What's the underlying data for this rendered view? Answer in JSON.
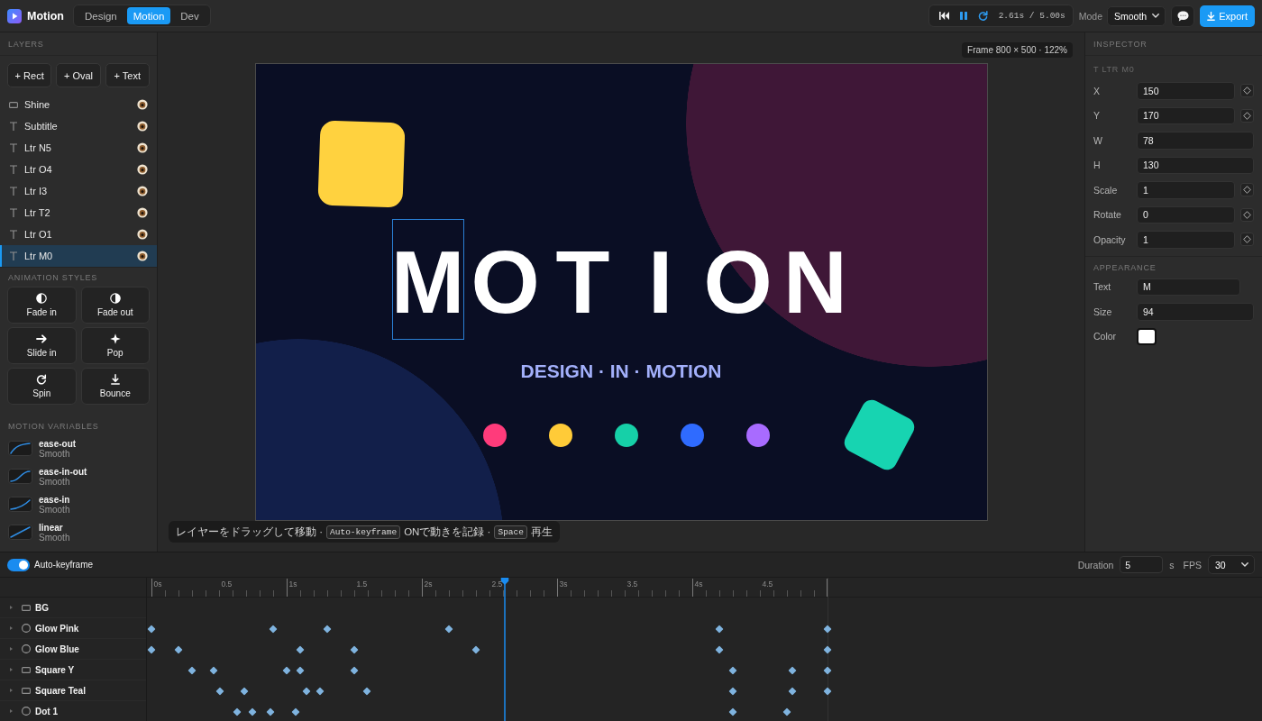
{
  "app": {
    "name": "Motion"
  },
  "mode_tabs": [
    {
      "label": "Design",
      "selected": false
    },
    {
      "label": "Motion",
      "selected": true
    },
    {
      "label": "Dev",
      "selected": false
    }
  ],
  "transport": {
    "playing": true,
    "loop": true,
    "time": "2.61s / 5.00s"
  },
  "mode": {
    "label": "Mode",
    "value": "Smooth"
  },
  "export": {
    "label": "Export"
  },
  "layers": {
    "title": "LAYERS",
    "add_buttons": [
      "+ Rect",
      "+ Oval",
      "+ Text"
    ],
    "items": [
      {
        "name": "Shine",
        "kind": "rect",
        "visible": true,
        "selected": false
      },
      {
        "name": "Subtitle",
        "kind": "text",
        "visible": true,
        "selected": false
      },
      {
        "name": "Ltr N5",
        "kind": "text",
        "visible": true,
        "selected": false
      },
      {
        "name": "Ltr O4",
        "kind": "text",
        "visible": true,
        "selected": false
      },
      {
        "name": "Ltr I3",
        "kind": "text",
        "visible": true,
        "selected": false
      },
      {
        "name": "Ltr T2",
        "kind": "text",
        "visible": true,
        "selected": false
      },
      {
        "name": "Ltr O1",
        "kind": "text",
        "visible": true,
        "selected": false
      },
      {
        "name": "Ltr M0",
        "kind": "text",
        "visible": true,
        "selected": true
      }
    ]
  },
  "animation_styles": {
    "title": "ANIMATION STYLES",
    "items": [
      {
        "label": "Fade in",
        "kind": "fadein"
      },
      {
        "label": "Fade out",
        "kind": "fadeout"
      },
      {
        "label": "Slide in",
        "kind": "slide"
      },
      {
        "label": "Pop",
        "kind": "pop"
      },
      {
        "label": "Spin",
        "kind": "spin"
      },
      {
        "label": "Bounce",
        "kind": "bounce"
      }
    ]
  },
  "motion_variables": {
    "title": "MOTION VARIABLES",
    "items": [
      {
        "name": "ease-out",
        "subtitle": "Smooth",
        "kind": "decelerate"
      },
      {
        "name": "ease-in-out",
        "subtitle": "Smooth",
        "kind": "scurve"
      },
      {
        "name": "ease-in",
        "subtitle": "Smooth",
        "kind": "accelerate"
      },
      {
        "name": "linear",
        "subtitle": "Smooth",
        "kind": "linear"
      }
    ]
  },
  "stage": {
    "frame_label": "Frame 800 × 500 · 122%",
    "letters": [
      {
        "text": "M",
        "selected": true
      },
      {
        "text": "O",
        "selected": false
      },
      {
        "text": "T",
        "selected": false
      },
      {
        "text": "I",
        "selected": false
      },
      {
        "text": "O",
        "selected": false
      },
      {
        "text": "N",
        "selected": false
      }
    ],
    "subtitle": "DESIGN · IN · MOTION",
    "dots": [
      {
        "color": "#ff3b7b"
      },
      {
        "color": "#ffcb38"
      },
      {
        "color": "#16d0a8"
      },
      {
        "color": "#2f6bff"
      },
      {
        "color": "#a86bff"
      }
    ]
  },
  "hint": [
    {
      "kind": "text",
      "text": "レイヤーをドラッグして移動 ·"
    },
    {
      "kind": "key",
      "text": "Auto-keyframe"
    },
    {
      "kind": "text",
      "text": "ONで動きを記録 ·"
    },
    {
      "kind": "key",
      "text": "Space"
    },
    {
      "kind": "text",
      "text": "再生"
    }
  ],
  "inspector": {
    "title": "INSPECTOR",
    "selection": "T LTR M0",
    "properties": [
      {
        "label": "X",
        "value": "150",
        "keyframe": true
      },
      {
        "label": "Y",
        "value": "170",
        "keyframe": true
      },
      {
        "label": "W",
        "value": "78",
        "keyframe": false
      },
      {
        "label": "H",
        "value": "130",
        "keyframe": false
      },
      {
        "label": "Scale",
        "value": "1",
        "keyframe": true
      },
      {
        "label": "Rotate",
        "value": "0",
        "keyframe": true
      },
      {
        "label": "Opacity",
        "value": "1",
        "keyframe": true
      }
    ],
    "appearance": {
      "title": "APPEARANCE",
      "fields": [
        {
          "label": "Text",
          "kind": "text",
          "value": "M"
        },
        {
          "label": "Size",
          "kind": "number",
          "value": "94"
        },
        {
          "label": "Color",
          "kind": "color",
          "color": "#ffffff"
        }
      ]
    }
  },
  "timeline": {
    "auto_keyframe": {
      "label": "Auto-keyframe",
      "on": true
    },
    "duration": {
      "label": "Duration",
      "value": "5",
      "unit": "s"
    },
    "fps": {
      "label": "FPS",
      "value": "30"
    },
    "ruler": [
      "0s",
      "0.5",
      "1s",
      "1.5",
      "2s",
      "2.5",
      "3s",
      "3.5",
      "4s",
      "4.5"
    ],
    "playhead": {
      "level": 0.522
    },
    "tracks": [
      {
        "name": "BG",
        "kind": "rect"
      },
      {
        "name": "Glow Pink",
        "kind": "oval",
        "keyframes": [
          {
            "level": 0
          },
          {
            "level": 0.18
          },
          {
            "level": 0.26
          },
          {
            "level": 0.44
          },
          {
            "level": 0.84
          },
          {
            "level": 1
          }
        ]
      },
      {
        "name": "Glow Blue",
        "kind": "oval",
        "keyframes": [
          {
            "level": 0
          },
          {
            "level": 0.04
          },
          {
            "level": 0.22
          },
          {
            "level": 0.3
          },
          {
            "level": 0.48
          },
          {
            "level": 0.84
          },
          {
            "level": 1
          }
        ]
      },
      {
        "name": "Square Y",
        "kind": "rect",
        "keyframes": [
          {
            "level": 0.06
          },
          {
            "level": 0.092
          },
          {
            "level": 0.2
          },
          {
            "level": 0.22
          },
          {
            "level": 0.3
          },
          {
            "level": 0.86
          },
          {
            "level": 0.948
          },
          {
            "level": 1
          }
        ]
      },
      {
        "name": "Square Teal",
        "kind": "rect",
        "keyframes": [
          {
            "level": 0.101
          },
          {
            "level": 0.137
          },
          {
            "level": 0.229
          },
          {
            "level": 0.249
          },
          {
            "level": 0.319
          },
          {
            "level": 0.86
          },
          {
            "level": 0.948
          },
          {
            "level": 1
          }
        ]
      },
      {
        "name": "Dot 1",
        "kind": "oval",
        "keyframes": [
          {
            "level": 0.127
          },
          {
            "level": 0.149
          },
          {
            "level": 0.176
          },
          {
            "level": 0.213
          },
          {
            "level": 0.86
          },
          {
            "level": 0.94
          }
        ]
      }
    ]
  }
}
